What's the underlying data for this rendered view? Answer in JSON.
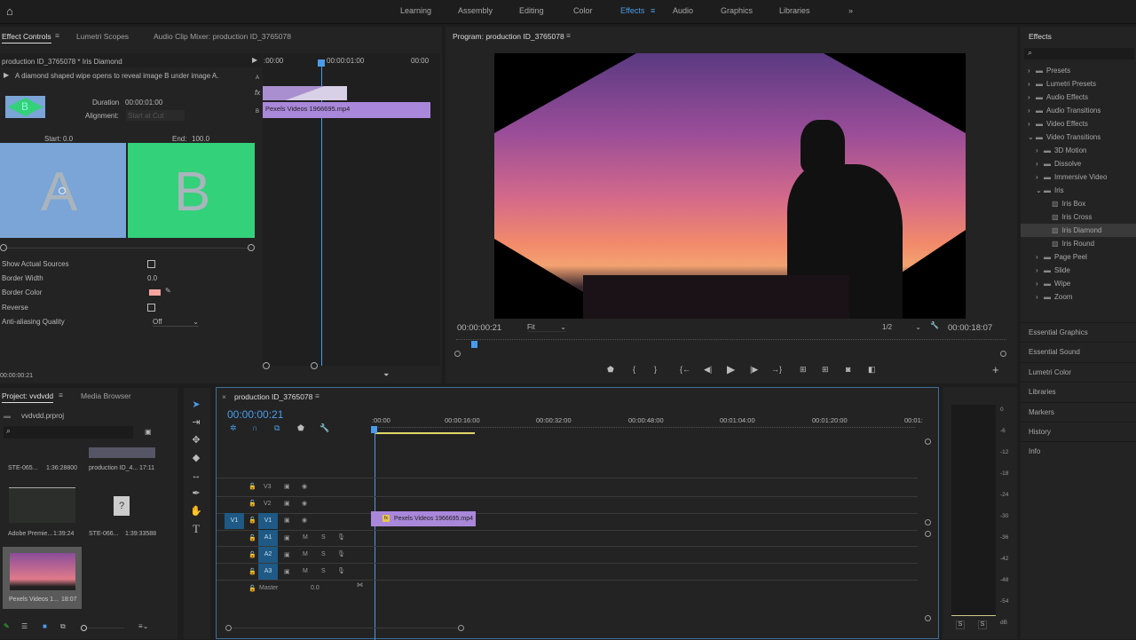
{
  "workspaces": [
    "Learning",
    "Assembly",
    "Editing",
    "Color",
    "Effects",
    "Audio",
    "Graphics",
    "Libraries"
  ],
  "active_workspace": "Effects",
  "effect_controls": {
    "tabs": [
      "Effect Controls",
      "Lumetri Scopes",
      "Audio Clip Mixer: production ID_3765078"
    ],
    "clip_title": "production ID_3765078 * Iris Diamond",
    "description": "A diamond shaped wipe opens to reveal image B under image A.",
    "duration_label": "Duration",
    "duration": "00:00:01:00",
    "alignment_label": "Alignment:",
    "alignment": "Start at Cut",
    "start_label": "Start:",
    "start": "0.0",
    "end_label": "End:",
    "end": "100.0",
    "a_label": "A",
    "b_label": "B",
    "thumb_b": "B",
    "props": [
      {
        "label": "Show Actual Sources"
      },
      {
        "label": "Border Width",
        "value": "0.0"
      },
      {
        "label": "Border Color",
        "color": "#f4a7a0"
      },
      {
        "label": "Reverse"
      },
      {
        "label": "Anti-aliasing Quality",
        "value": "Off"
      }
    ],
    "mini_ruler": [
      ":00:00",
      "00:00:01:00",
      "00:00"
    ],
    "track_a": "A",
    "track_b": "B",
    "fx": "fx",
    "clip_name": "Pexels Videos 1966695.mp4",
    "timecode": "00:00:00:21"
  },
  "program": {
    "title": "Program: production ID_3765078",
    "timecode": "00:00:00:21",
    "fit": "Fit",
    "resolution": "1/2",
    "duration": "00:00:18:07"
  },
  "effects_panel": {
    "title": "Effects",
    "items": [
      {
        "label": "Presets",
        "level": 0
      },
      {
        "label": "Lumetri Presets",
        "level": 0
      },
      {
        "label": "Audio Effects",
        "level": 0
      },
      {
        "label": "Audio Transitions",
        "level": 0
      },
      {
        "label": "Video Effects",
        "level": 0
      },
      {
        "label": "Video Transitions",
        "level": 0,
        "open": true
      },
      {
        "label": "3D Motion",
        "level": 1
      },
      {
        "label": "Dissolve",
        "level": 1
      },
      {
        "label": "Immersive Video",
        "level": 1
      },
      {
        "label": "Iris",
        "level": 1,
        "open": true
      },
      {
        "label": "Iris Box",
        "level": 2
      },
      {
        "label": "Iris Cross",
        "level": 2
      },
      {
        "label": "Iris Diamond",
        "level": 2,
        "selected": true
      },
      {
        "label": "Iris Round",
        "level": 2
      },
      {
        "label": "Page Peel",
        "level": 1
      },
      {
        "label": "Slide",
        "level": 1
      },
      {
        "label": "Wipe",
        "level": 1
      },
      {
        "label": "Zoom",
        "level": 1
      }
    ],
    "side_panels": [
      "Essential Graphics",
      "Essential Sound",
      "Lumetri Color",
      "Libraries",
      "Markers",
      "History",
      "Info"
    ]
  },
  "project": {
    "tabs": [
      "Project: vvdvdd",
      "Media Browser"
    ],
    "file": "vvdvdd.prproj",
    "items": [
      {
        "name": "STE-065...",
        "dur": "1:36:28800"
      },
      {
        "name": "production ID_4...",
        "dur": "17:11"
      },
      {
        "name": "Adobe Premie...",
        "dur": "1:39:24"
      },
      {
        "name": "STE-066...",
        "dur": "1:39:33588"
      },
      {
        "name": "Pexels Videos 1...",
        "dur": "18:07"
      }
    ]
  },
  "timeline": {
    "title": "production ID_3765078",
    "timecode": "00:00:00:21",
    "ruler": [
      ":00:00",
      "00:00:16:00",
      "00:00:32:00",
      "00:00:48:00",
      "00:01:04:00",
      "00:01:20:00",
      "00:01:"
    ],
    "video_tracks": [
      "V3",
      "V2",
      "V1"
    ],
    "audio_tracks": [
      "A1",
      "A2",
      "A3"
    ],
    "source_v": "V1",
    "master": "Master",
    "master_val": "0.0",
    "clip": "Pexels Videos 1966695.mp4",
    "fx": "fx",
    "m": "M",
    "s": "S"
  },
  "meter": {
    "ticks": [
      "0",
      "-6",
      "-12",
      "-18",
      "-24",
      "-30",
      "-36",
      "-42",
      "-48",
      "-54",
      "dB"
    ],
    "solo": [
      "S",
      "S"
    ]
  }
}
